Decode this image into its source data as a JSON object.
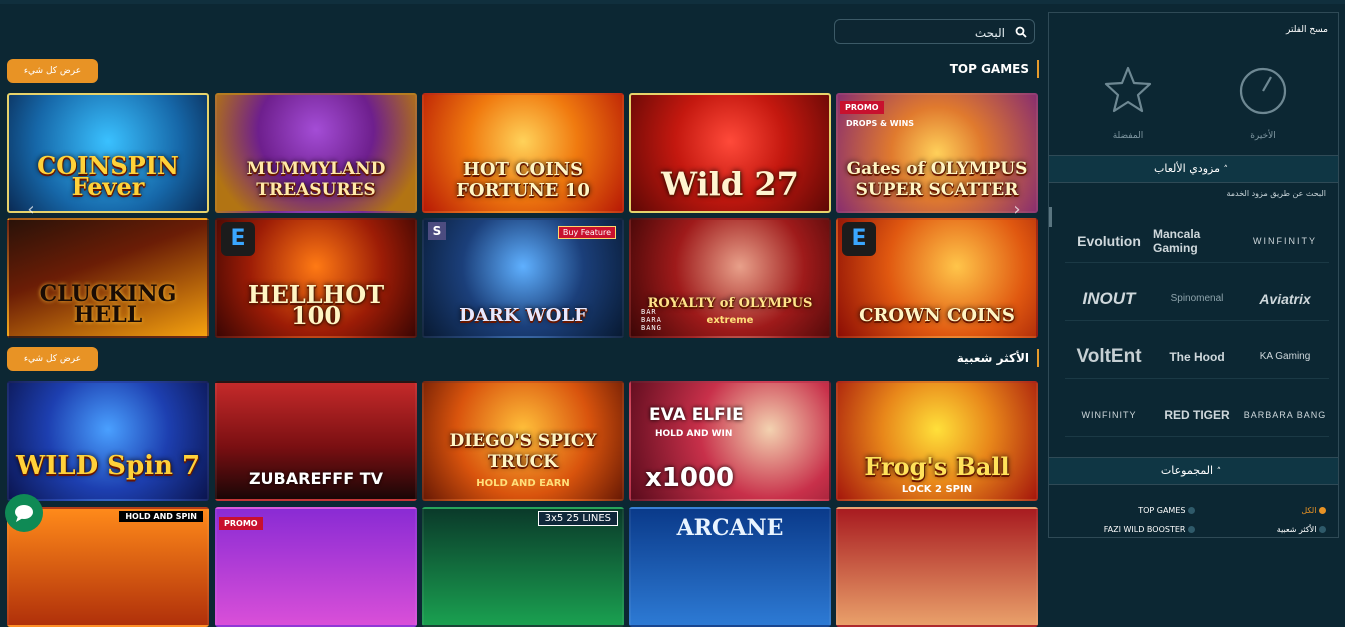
{
  "search": {
    "placeholder": "البحث"
  },
  "sections": [
    {
      "title": "TOP GAMES",
      "view_all": "عرض كل شيء"
    },
    {
      "title": "الأكثر شعبية",
      "view_all": "عرض كل شيء"
    }
  ],
  "top_games": [
    {
      "name": "Coin Spin Fever",
      "label": "COINSPIN Fever"
    },
    {
      "name": "Mummyland Treasures",
      "label": "MUMMYLAND TREASURES"
    },
    {
      "name": "Hot Coins Fortune 10",
      "label": "HOT COINS FORTUNE 10"
    },
    {
      "name": "Wild 27",
      "label": "Wild 27"
    },
    {
      "name": "Gates of Olympus Super Scatter",
      "label": "Gates of OLYMPUS SUPER SCATTER",
      "badge": "PROMO",
      "tag": "DROPS & WINS"
    },
    {
      "name": "Clucking Hell",
      "label": "CLUCKING HELL"
    },
    {
      "name": "Hell Hot 100",
      "label": "HELLHOT 100"
    },
    {
      "name": "Dark Wolf",
      "label": "DARK WOLF",
      "feature": "Buy Feature"
    },
    {
      "name": "Royalty of Olympus Extreme",
      "label": "ROYALTY of OLYMPUS",
      "sub": "extreme",
      "studio": "BAR BARA BANG"
    },
    {
      "name": "Crown Coins",
      "label": "CROWN COINS"
    }
  ],
  "popular_games": [
    {
      "name": "Wild Spin",
      "label": "WILD Spin 7"
    },
    {
      "name": "Zubarefff TV",
      "label": "ZUBAREFFF TV"
    },
    {
      "name": "Diego's Spicy Truck",
      "label": "DIEGO'S SPICY TRUCK",
      "sub": "HOLD AND EARN"
    },
    {
      "name": "Eva Elfie Hold and Win",
      "label": "EVA ELFIE",
      "sub": "HOLD AND WIN",
      "extra": "x1000"
    },
    {
      "name": "Frog's Ball",
      "label": "Frog's Ball",
      "sub": "LOCK 2 SPIN"
    }
  ],
  "partial_games": [
    {
      "tag": "HOLD AND SPIN"
    },
    {
      "badge": "PROMO"
    },
    {
      "tag": "3x5   25 LINES"
    },
    {
      "label": "ARCANE"
    },
    {
      "tag": ""
    }
  ],
  "panel": {
    "clear_filter": "مسح الفلتر",
    "favorites": "المفضلة",
    "recent": "الأخيرة",
    "providers_title": "مزودي الألعاب",
    "provider_search": "البحث عن طريق مزود الخدمة",
    "providers": [
      "WINFINITY",
      "Mancala Gaming",
      "Evolution",
      "Aviatrix",
      "Spinomenal",
      "INOUT",
      "KA Gaming",
      "The Hood",
      "VoltEnt",
      "BARBARA BANG",
      "RED TIGER",
      "WINFINITY"
    ],
    "collections_title": "المجموعات",
    "collections": [
      {
        "label": "الكل",
        "active": true
      },
      {
        "label": "TOP GAMES",
        "active": false
      },
      {
        "label": "الأكثر شعبية",
        "active": false
      },
      {
        "label": "FAZI WILD BOOSTER",
        "active": false
      }
    ]
  },
  "colors": {
    "accent": "#e89325",
    "background": "#0c2733",
    "panel_header": "#0f3644"
  }
}
